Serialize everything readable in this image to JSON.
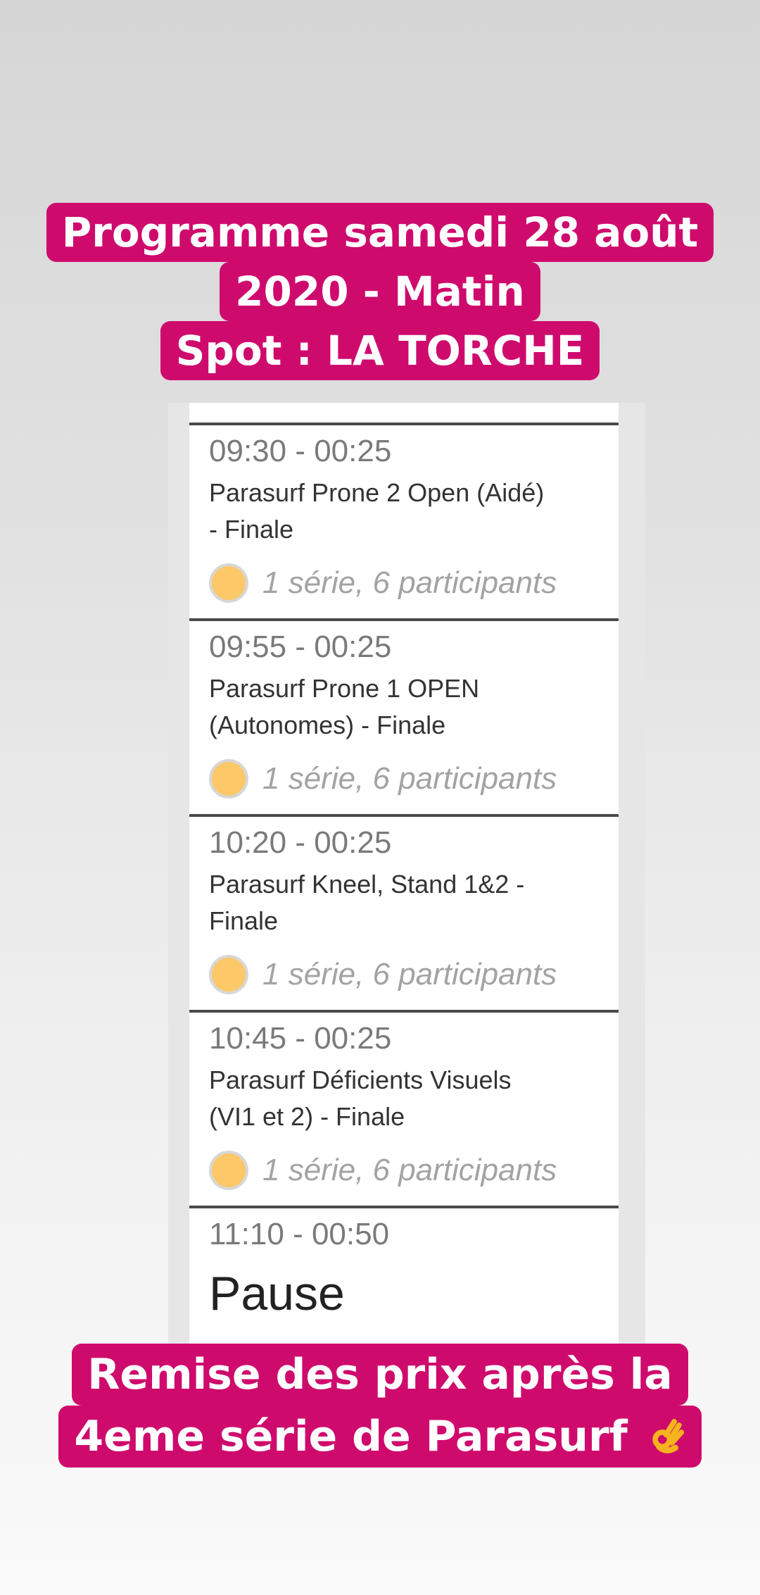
{
  "caption_top": {
    "lines": [
      "Programme samedi 28 août",
      "2020 - Matin",
      "Spot : LA TORCHE"
    ]
  },
  "schedule": {
    "items": [
      {
        "time": "09:30 - 00:25",
        "title_lines": [
          "Parasurf Prone 2 Open (Aidé)",
          "- Finale"
        ],
        "heats": "1 série, 6 participants"
      },
      {
        "time": "09:55 - 00:25",
        "title_lines": [
          "Parasurf Prone 1 OPEN",
          "(Autonomes) - Finale"
        ],
        "heats": "1 série, 6 participants"
      },
      {
        "time": "10:20 - 00:25",
        "title_lines": [
          "Parasurf Kneel, Stand 1&2 -",
          "Finale"
        ],
        "heats": "1 série, 6 participants"
      },
      {
        "time": "10:45 - 00:25",
        "title_lines": [
          "Parasurf Déficients Visuels",
          "(VI1 et 2) - Finale"
        ],
        "heats": "1 série, 6 participants"
      }
    ],
    "pause": {
      "time": "11:10 - 00:50",
      "title": "Pause"
    }
  },
  "caption_bottom": {
    "lines": [
      "Remise des prix après la",
      "4eme série de Parasurf"
    ],
    "emoji": "ok-hand-emoji"
  },
  "colors": {
    "caption_bg": "#cf0a6d",
    "heat_dot": "#fcc868"
  }
}
